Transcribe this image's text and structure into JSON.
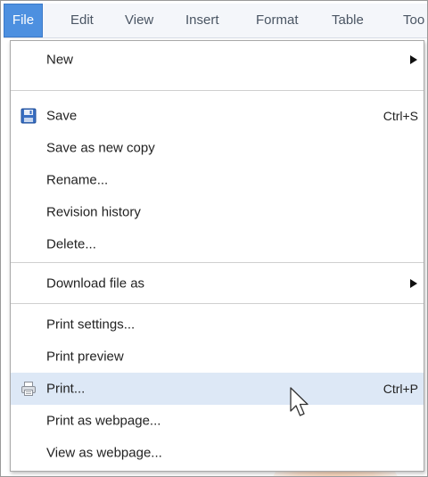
{
  "menubar": {
    "items": [
      {
        "label": "File",
        "active": true
      },
      {
        "label": "Edit",
        "active": false
      },
      {
        "label": "View",
        "active": false
      },
      {
        "label": "Insert",
        "active": false
      },
      {
        "label": "Format",
        "active": false
      },
      {
        "label": "Table",
        "active": false
      },
      {
        "label": "Too",
        "active": false
      }
    ]
  },
  "file_menu": {
    "new": {
      "label": "New"
    },
    "save": {
      "label": "Save",
      "shortcut": "Ctrl+S",
      "icon": "floppy-disk-icon"
    },
    "save_copy": {
      "label": "Save as new copy"
    },
    "rename": {
      "label": "Rename..."
    },
    "revision_history": {
      "label": "Revision history"
    },
    "delete": {
      "label": "Delete..."
    },
    "download": {
      "label": "Download file as"
    },
    "print_settings": {
      "label": "Print settings..."
    },
    "print_preview": {
      "label": "Print preview"
    },
    "print": {
      "label": "Print...",
      "shortcut": "Ctrl+P",
      "icon": "printer-icon",
      "hovered": true
    },
    "print_webpage": {
      "label": "Print as webpage..."
    },
    "view_webpage": {
      "label": "View as webpage..."
    }
  },
  "colors": {
    "menubar_bg": "#f4f6fa",
    "active_menu": "#4d90e0",
    "hover_row": "#dde8f6",
    "separator": "#cfcfcf"
  }
}
